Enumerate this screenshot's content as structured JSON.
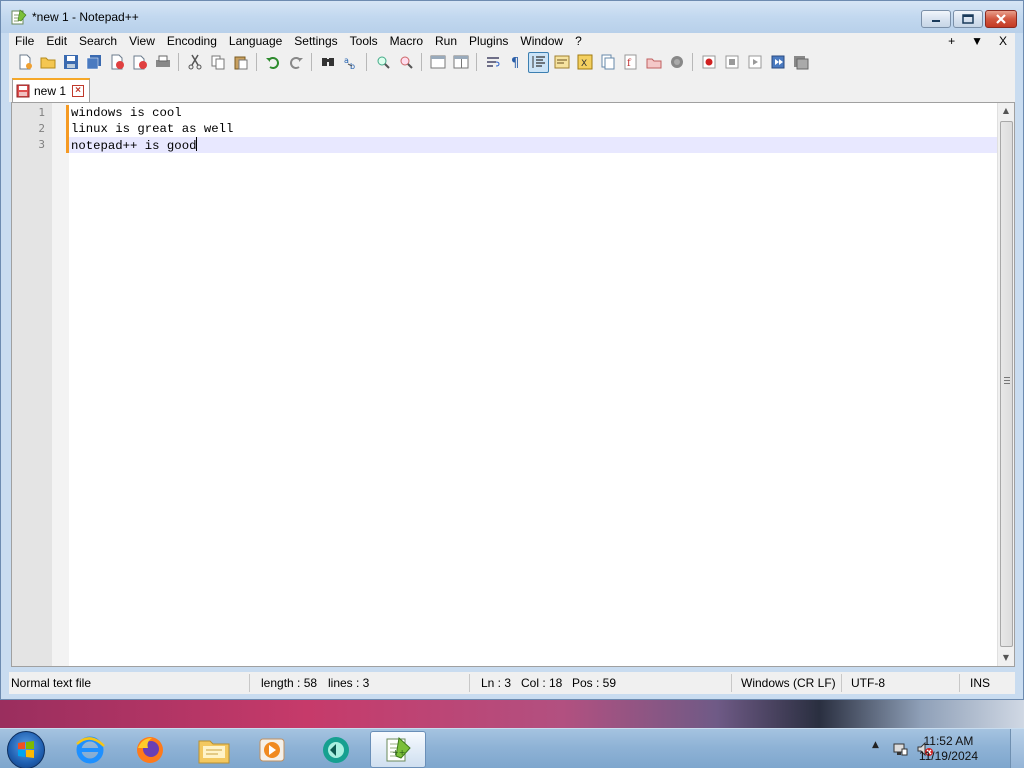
{
  "window": {
    "title": "*new 1 - Notepad++",
    "minimize_icon": "minimize-icon",
    "maximize_icon": "restore-icon",
    "close_icon": "close-icon"
  },
  "menu": {
    "items": [
      "File",
      "Edit",
      "Search",
      "View",
      "Encoding",
      "Language",
      "Settings",
      "Tools",
      "Macro",
      "Run",
      "Plugins",
      "Window",
      "?"
    ],
    "right": [
      "+",
      "▼",
      "X"
    ]
  },
  "toolbar": {
    "groups": [
      [
        "new-file-icon",
        "open-file-icon",
        "save-icon",
        "save-all-icon",
        "close-icon",
        "close-all-icon",
        "print-icon"
      ],
      [
        "cut-icon",
        "copy-icon",
        "paste-icon"
      ],
      [
        "undo-icon",
        "redo-icon"
      ],
      [
        "find-icon",
        "replace-icon"
      ],
      [
        "zoom-in-icon",
        "zoom-out-icon"
      ],
      [
        "sync-vertical-icon",
        "sync-horizontal-icon"
      ],
      [
        "word-wrap-icon",
        "show-all-chars-icon",
        "indent-guide-icon",
        "udl-icon",
        "document-map-icon",
        "function-list-icon",
        "folder-workspace-icon",
        "monitoring-icon",
        "doc-list-icon"
      ],
      [
        "record-macro-icon",
        "stop-record-icon",
        "play-macro-icon",
        "play-multiple-icon",
        "save-macro-icon"
      ]
    ],
    "active": "indent-guide-icon"
  },
  "tabs": [
    {
      "label": "new 1",
      "icon": "unsaved-file-icon",
      "close_icon": "tab-close-icon"
    }
  ],
  "editor": {
    "lines": [
      "windows is cool",
      "linux is great as well",
      "notepad++ is good"
    ],
    "line_numbers": [
      "1",
      "2",
      "3"
    ],
    "current_line": 3
  },
  "status": {
    "file_type": "Normal text file",
    "length": "length : 58",
    "lines": "lines : 3",
    "ln": "Ln : 3",
    "col": "Col : 18",
    "pos": "Pos : 59",
    "eol": "Windows (CR LF)",
    "encoding": "UTF-8",
    "mode": "INS"
  },
  "taskbar": {
    "apps": [
      "internet-explorer-icon",
      "firefox-icon",
      "file-explorer-icon",
      "media-player-icon",
      "app-icon",
      "notepadpp-icon"
    ],
    "active_app": "notepadpp-icon",
    "tray": [
      "show-hidden-icons",
      "network-icon",
      "volume-muted-icon"
    ],
    "time": "11:52 AM",
    "date": "11/19/2024"
  },
  "colors": {
    "accent_orange": "#f6a828",
    "current_line": "#e8e8ff",
    "title_bar": "#c2d8ef"
  }
}
